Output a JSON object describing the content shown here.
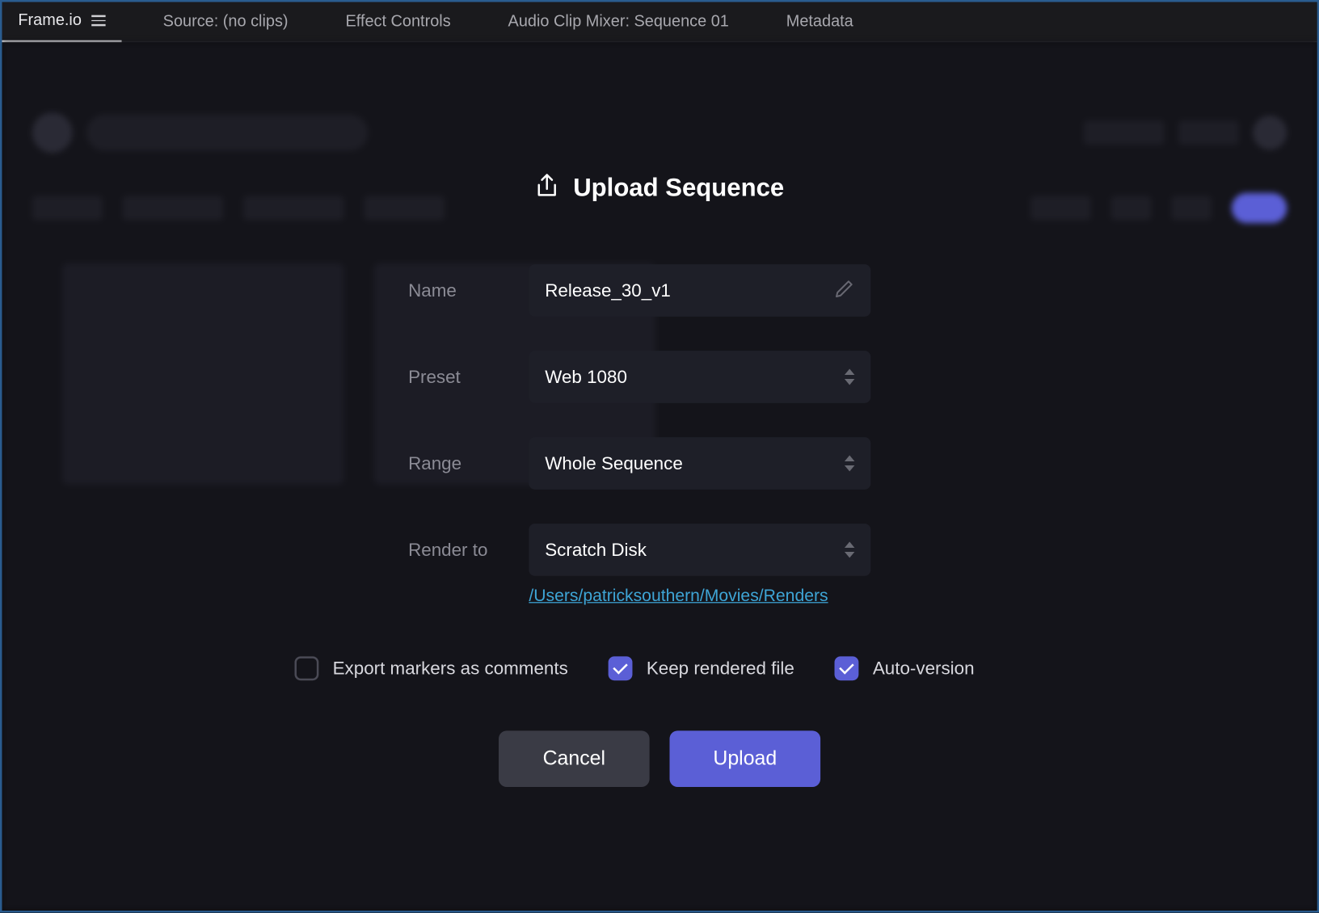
{
  "tabs": {
    "frameio": "Frame.io",
    "source": "Source: (no clips)",
    "effect_controls": "Effect Controls",
    "audio_mixer": "Audio Clip Mixer: Sequence 01",
    "metadata": "Metadata"
  },
  "modal": {
    "title": "Upload Sequence",
    "fields": {
      "name": {
        "label": "Name",
        "value": "Release_30_v1"
      },
      "preset": {
        "label": "Preset",
        "value": "Web 1080"
      },
      "range": {
        "label": "Range",
        "value": "Whole Sequence"
      },
      "render_to": {
        "label": "Render to",
        "value": "Scratch Disk"
      }
    },
    "render_path": "/Users/patricksouthern/Movies/Renders",
    "checkboxes": {
      "export_markers": {
        "label": "Export markers as comments",
        "checked": false
      },
      "keep_rendered": {
        "label": "Keep rendered file",
        "checked": true
      },
      "auto_version": {
        "label": "Auto-version",
        "checked": true
      }
    },
    "buttons": {
      "cancel": "Cancel",
      "upload": "Upload"
    }
  }
}
